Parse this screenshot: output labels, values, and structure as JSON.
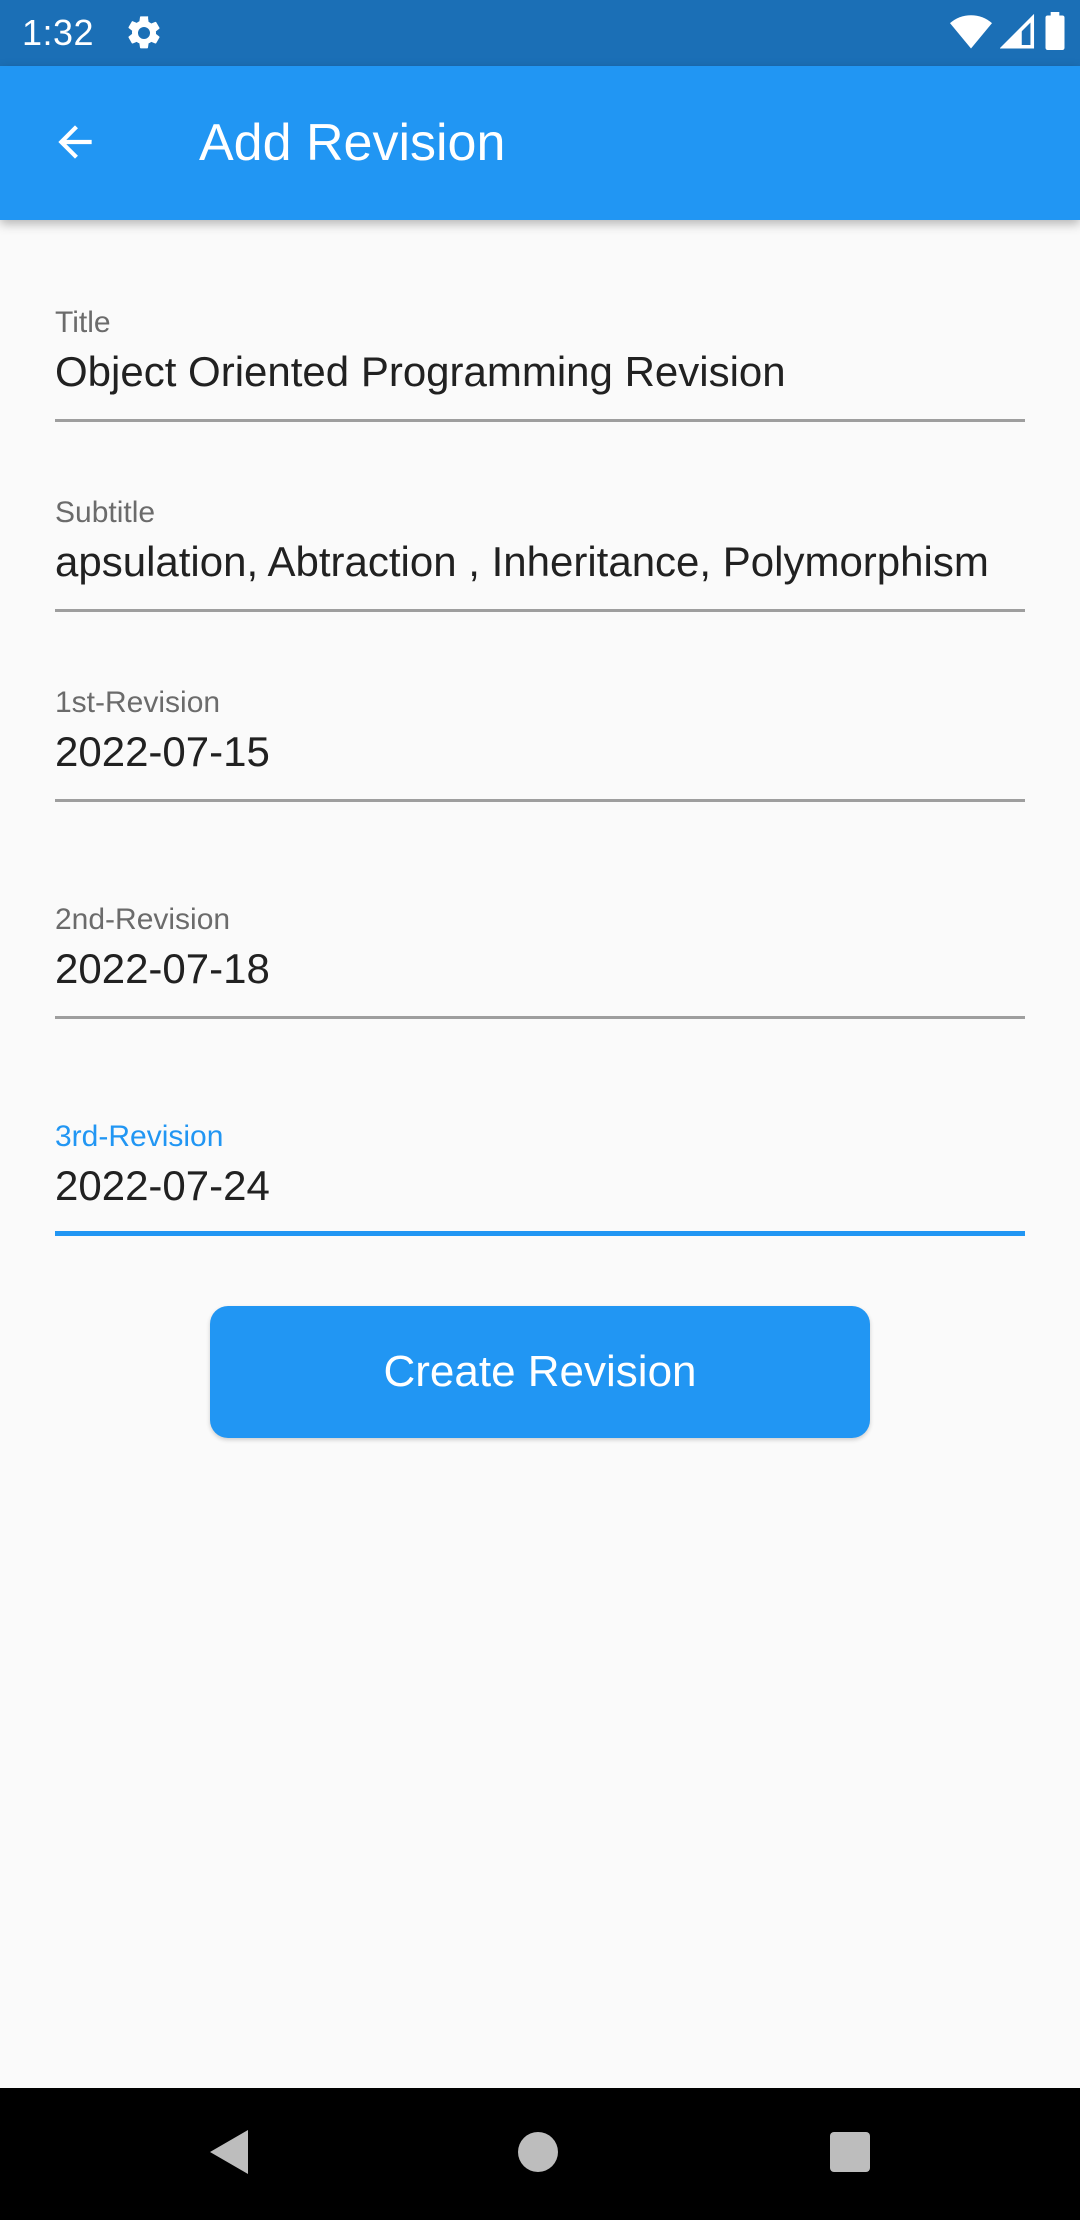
{
  "status_bar": {
    "time": "1:32",
    "icons": [
      "gear-icon",
      "wifi-icon",
      "signal-icon",
      "battery-icon"
    ]
  },
  "app_bar": {
    "title": "Add Revision",
    "back_icon": "arrow-back-icon"
  },
  "form": {
    "fields": [
      {
        "label": "Title",
        "value": "Object Oriented Programming Revision"
      },
      {
        "label": "Subtitle",
        "value": "apsulation, Abtraction , Inheritance, Polymorphism"
      },
      {
        "label": "1st-Revision",
        "value": "2022-07-15"
      },
      {
        "label": "2nd-Revision",
        "value": "2022-07-18"
      },
      {
        "label": "3rd-Revision",
        "value": "2022-07-24",
        "focused": true
      }
    ]
  },
  "actions": {
    "create_label": "Create Revision"
  },
  "navigation": {
    "icons": [
      "back-triangle-icon",
      "home-circle-icon",
      "recents-square-icon"
    ]
  },
  "colors": {
    "status_bar": "#1b6fb6",
    "app_bar": "#2196f3",
    "accent": "#2196f3",
    "background": "#fafafa",
    "nav_bar": "#000000"
  }
}
